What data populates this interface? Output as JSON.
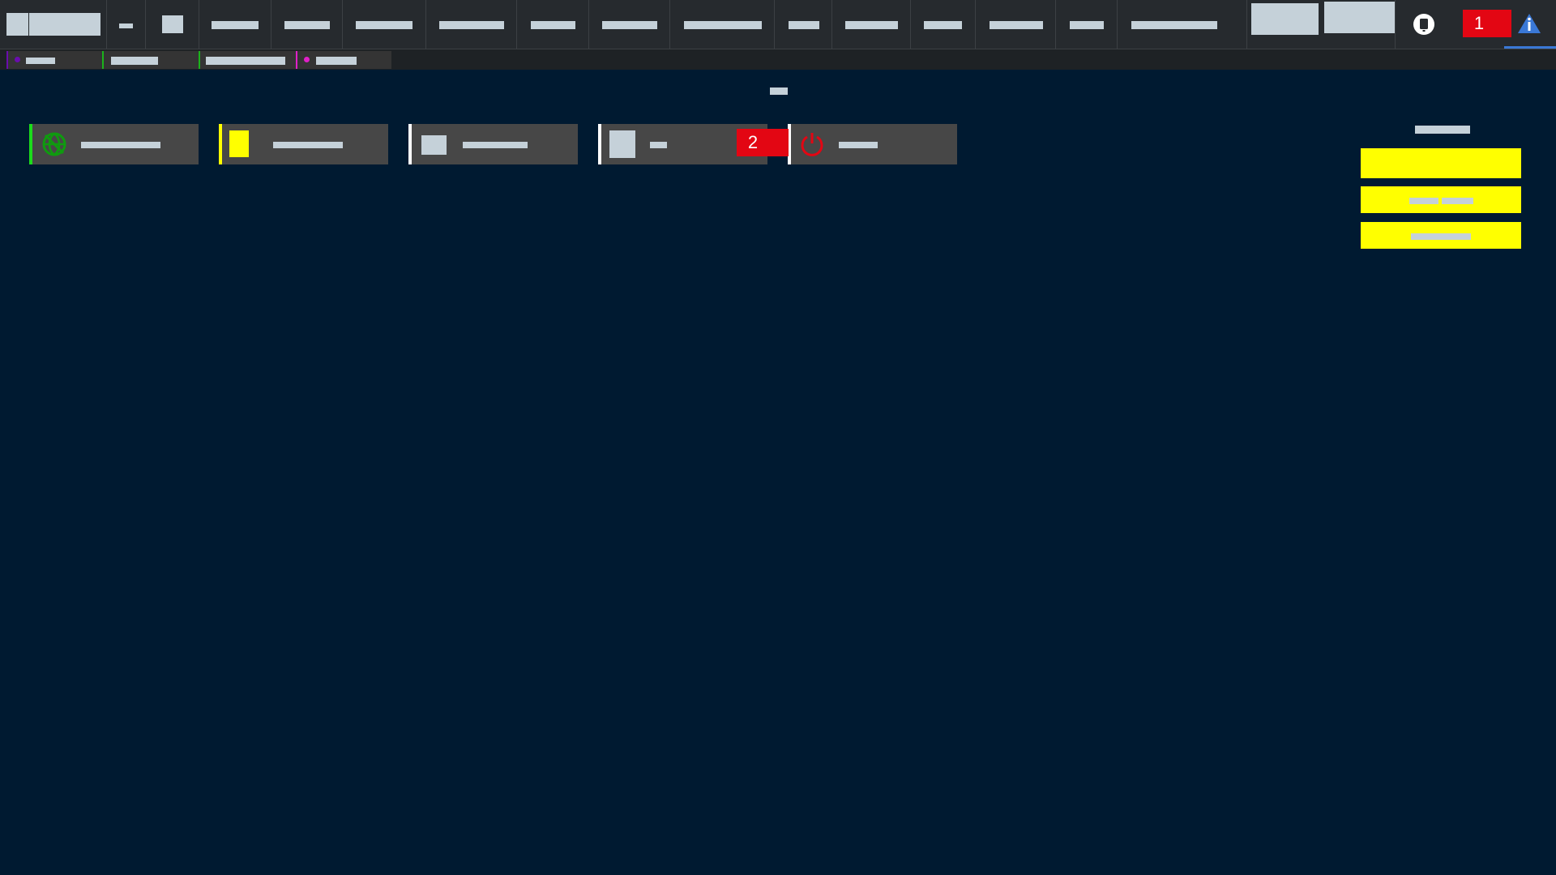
{
  "toolbar": {
    "items": [
      "home",
      "minimize",
      "tile-view",
      "menu-1",
      "menu-2",
      "menu-3",
      "menu-4",
      "menu-5",
      "menu-6",
      "menu-7",
      "menu-8",
      "menu-9",
      "menu-10",
      "menu-11",
      "menu-12",
      "menu-13",
      "panel-a",
      "panel-b"
    ]
  },
  "callouts": {
    "first": "1",
    "second": "2"
  },
  "status_colors": {
    "tab1": "#6a0dad",
    "tab2": "#1bb31b",
    "tab3": "#1bb31b",
    "tab4": "#e020c8",
    "card1": "#1bdc1b",
    "card2": "#ffff00",
    "card3": "#ffffff",
    "card4": "#ffffff",
    "card5": "#ffffff"
  },
  "icons": {
    "card1": "globe-icon",
    "card2": "yellow-square-icon",
    "card3": "square-icon",
    "card4": "square-icon",
    "card5": "power-icon",
    "topbar_device": "mobile-device-icon",
    "topbar_info": "info-triangle-icon"
  }
}
